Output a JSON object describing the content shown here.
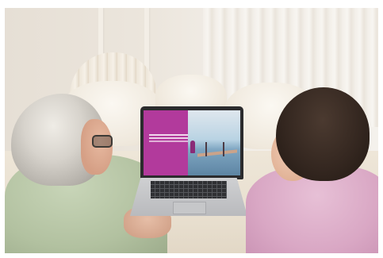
{
  "scene": {
    "description_label": "",
    "colors": {
      "screen_accent": "#b23a9c",
      "left_shirt": "#b2c1a0",
      "right_shirt": "#d9a7c4"
    }
  }
}
